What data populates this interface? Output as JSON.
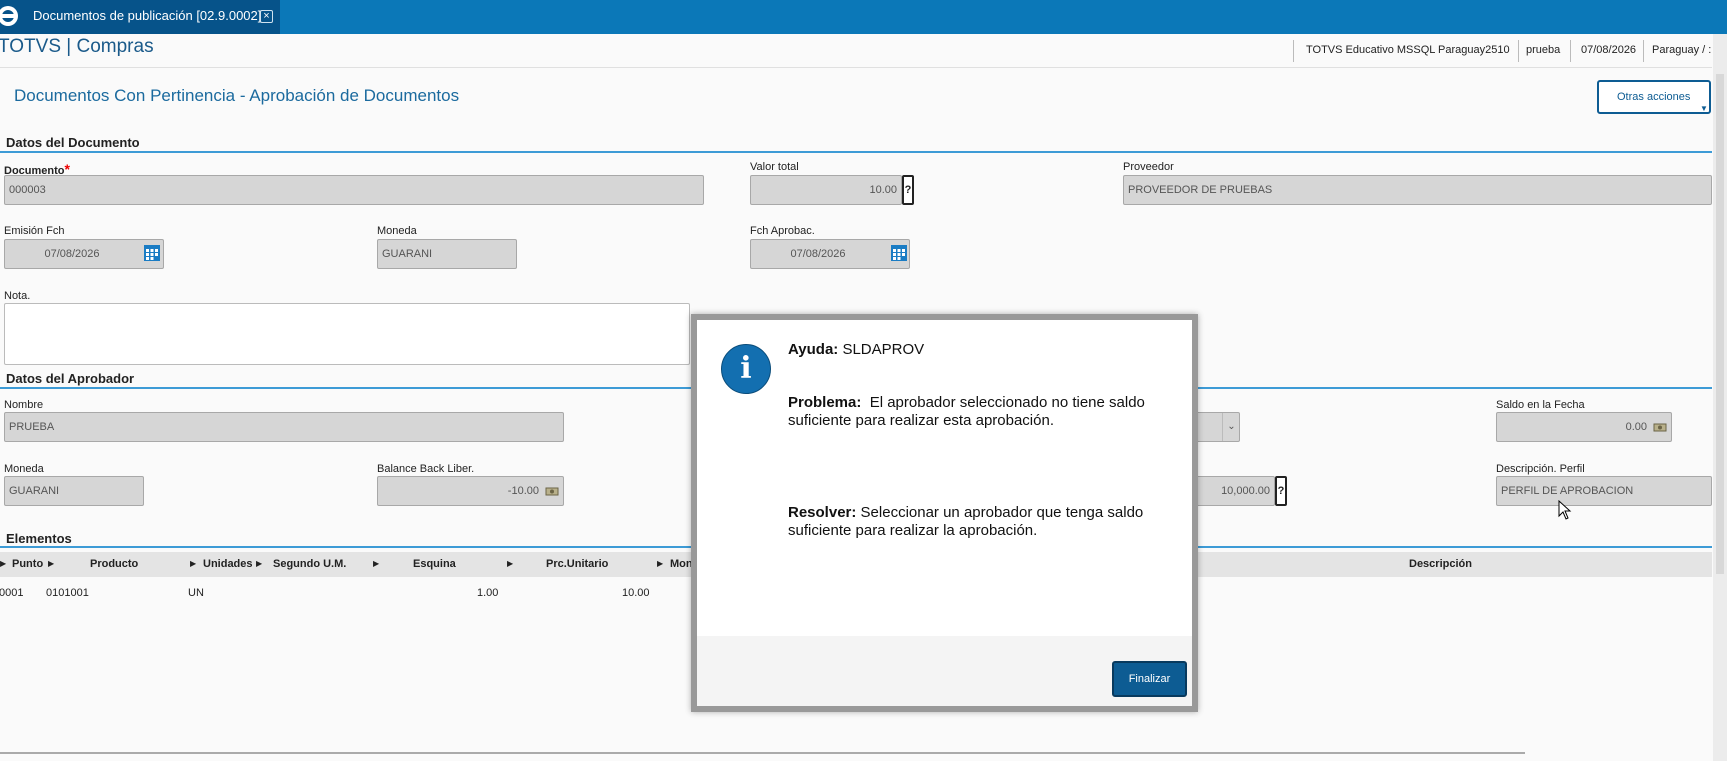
{
  "tab": {
    "title": "Documentos de publicación [02.9.0002]",
    "close": "×"
  },
  "header": {
    "app_title": "TOTVS | Compras",
    "environment": "TOTVS Educativo MSSQL Paraguay2510",
    "user": "prueba",
    "date": "07/08/2026",
    "country": "Paraguay / :"
  },
  "page": {
    "title": "Documentos Con Pertinencia - Aprobación de Documentos",
    "other_actions": "Otras acciones"
  },
  "doc_section": {
    "title": "Datos del Documento",
    "documento": {
      "label": "Documento",
      "required": "*",
      "value": "000003"
    },
    "valor_total": {
      "label": "Valor total",
      "value": "10.00",
      "help": "?"
    },
    "proveedor": {
      "label": "Proveedor",
      "value": "PROVEEDOR DE PRUEBAS"
    },
    "emision": {
      "label": "Emisión Fch",
      "value": "07/08/2026"
    },
    "moneda": {
      "label": "Moneda",
      "value": "GUARANI"
    },
    "fch_aprob": {
      "label": "Fch Aprobac.",
      "value": "07/08/2026"
    },
    "nota": {
      "label": "Nota."
    }
  },
  "approver_section": {
    "title": "Datos del Aprobador",
    "nombre": {
      "label": "Nombre",
      "value": "PRUEBA"
    },
    "saldo_fecha": {
      "label": "Saldo en la Fecha",
      "value": "0.00"
    },
    "moneda": {
      "label": "Moneda",
      "value": "GUARANI"
    },
    "balance": {
      "label": "Balance Back Liber.",
      "value": "-10.00"
    },
    "limite": {
      "value": "10,000.00",
      "help": "?"
    },
    "perfil": {
      "label": "Descripción. Perfil",
      "value": "PERFIL DE APROBACION"
    }
  },
  "elements_section": {
    "title": "Elementos",
    "columns": [
      "Punto",
      "Producto",
      "Unidades",
      "Segundo U.M.",
      "Esquina",
      "Prc.Unitario",
      "Mon",
      "Descripción"
    ],
    "rows": [
      {
        "punto": "0001",
        "producto": "0101001",
        "unidad": "UN",
        "esquina": "1.00",
        "precio": "10.00"
      }
    ]
  },
  "dialog": {
    "ayuda_label": "Ayuda:",
    "ayuda_value": "SLDAPROV",
    "problema_label": "Problema:",
    "problema_text": "El aprobador seleccionado no tiene saldo suficiente para realizar esta aprobación.",
    "resolver_label": "Resolver:",
    "resolver_text": "Seleccionar un aprobador que tenga saldo suficiente para realizar la aprobación.",
    "button": "Finalizar",
    "icon": "info-icon"
  },
  "colors": {
    "accent": "#0b78b8",
    "tab_active": "#06538a",
    "button": "#0d5c93",
    "section_line": "#3d9bd6"
  }
}
